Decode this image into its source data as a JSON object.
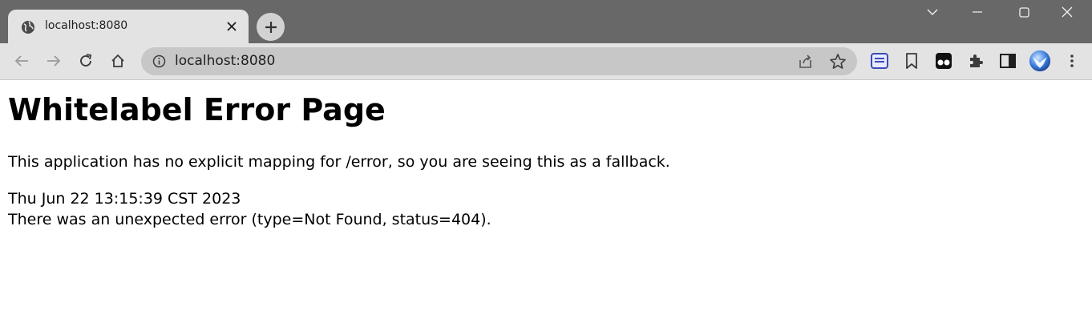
{
  "browser": {
    "tab_title": "localhost:8080",
    "url": "localhost:8080",
    "icons": {
      "favicon": "globe-icon",
      "tab_close": "close-icon",
      "new_tab": "plus-icon",
      "back": "arrow-left-icon",
      "forward": "arrow-right-icon",
      "reload": "reload-icon",
      "home": "home-icon",
      "site_info": "info-icon",
      "share": "share-icon",
      "bookmark_star": "star-icon",
      "reading_list": "reading-list-icon",
      "bookmark": "bookmark-icon",
      "tampermonkey": "tampermonkey-icon",
      "extensions": "puzzle-icon",
      "side_panel": "side-panel-icon",
      "profile": "avatar",
      "menu": "more-vert-icon",
      "tab_search": "chevron-down-icon",
      "minimize": "minimize-icon",
      "maximize": "maximize-icon",
      "close_window": "close-icon"
    },
    "colors": {
      "titlebar": "#686868",
      "toolbar": "#e3e3e3",
      "omnibox": "#c7c7c7",
      "reading_list_accent": "#3b4bb8"
    }
  },
  "page": {
    "heading": "Whitelabel Error Page",
    "message": "This application has no explicit mapping for /error, so you are seeing this as a fallback.",
    "timestamp": "Thu Jun 22 13:15:39 CST 2023",
    "error_detail": "There was an unexpected error (type=Not Found, status=404)."
  }
}
